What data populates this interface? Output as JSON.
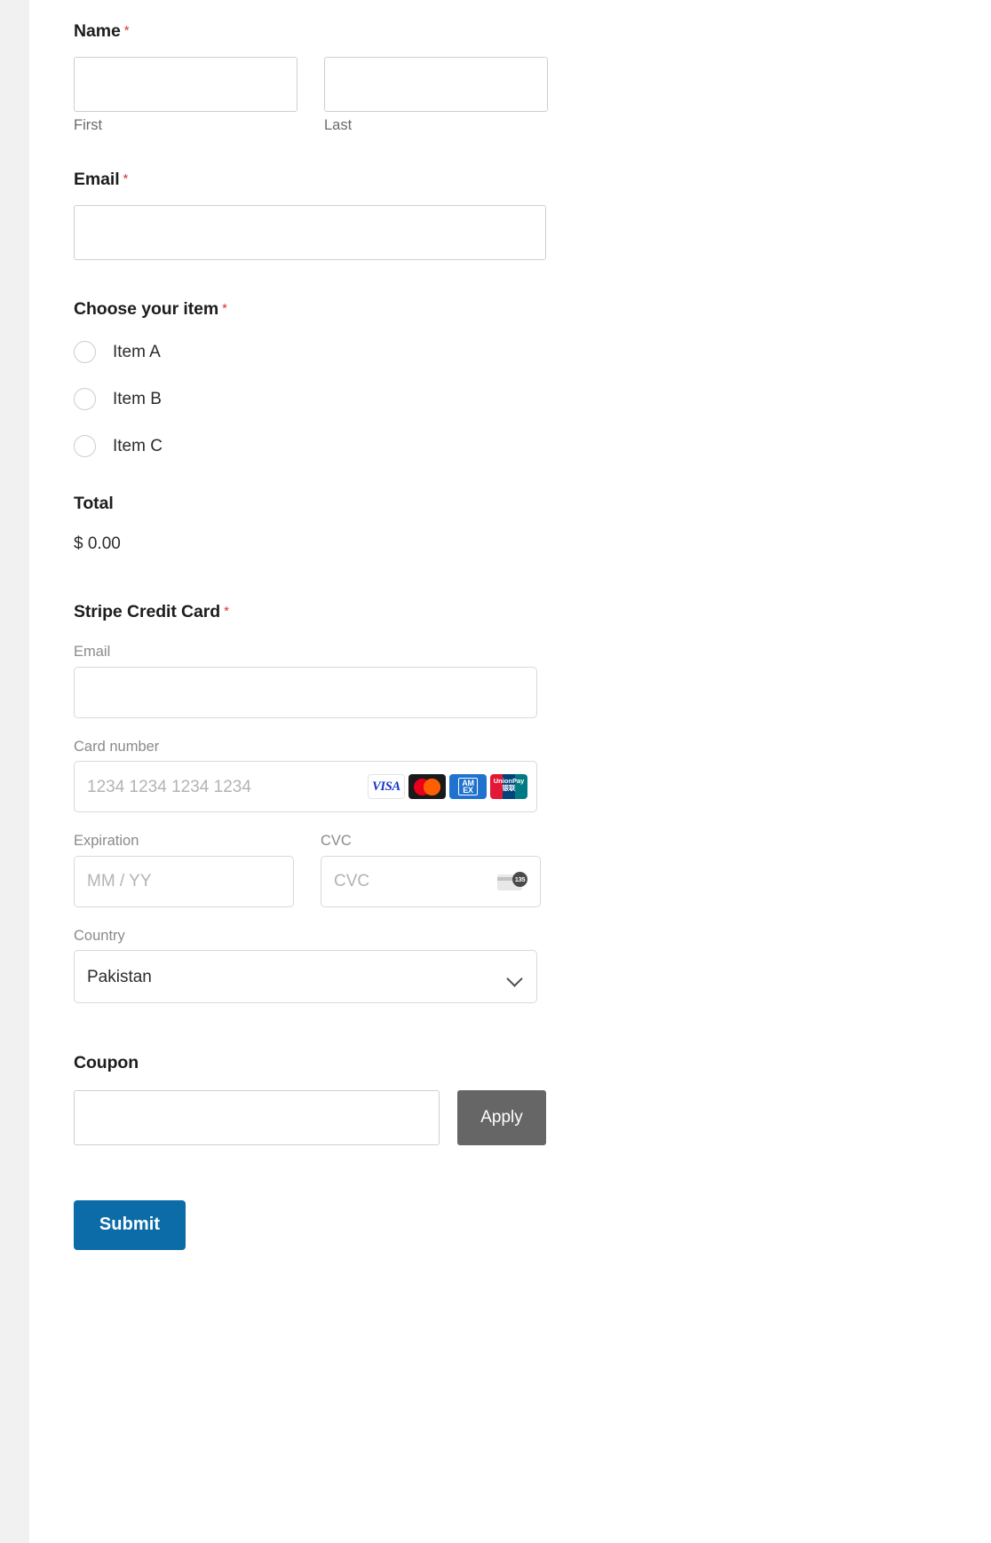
{
  "form": {
    "name": {
      "label": "Name",
      "required_mark": "*",
      "first": {
        "value": "",
        "sublabel": "First"
      },
      "last": {
        "value": "",
        "sublabel": "Last"
      }
    },
    "email": {
      "label": "Email",
      "required_mark": "*",
      "value": ""
    },
    "choose_item": {
      "label": "Choose your item",
      "required_mark": "*",
      "options": [
        {
          "label": "Item A",
          "selected": false
        },
        {
          "label": "Item B",
          "selected": false
        },
        {
          "label": "Item C",
          "selected": false
        }
      ]
    },
    "total": {
      "label": "Total",
      "value": "$ 0.00"
    },
    "stripe": {
      "label": "Stripe Credit Card",
      "required_mark": "*",
      "email": {
        "label": "Email",
        "value": ""
      },
      "card_number": {
        "label": "Card number",
        "placeholder": "1234 1234 1234 1234",
        "value": "",
        "brands": [
          "visa-icon",
          "mastercard-icon",
          "amex-icon",
          "unionpay-icon"
        ],
        "brand_text": {
          "visa": "VISA",
          "amex_line1": "AM",
          "amex_line2": "EX",
          "unionpay_line1": "UnionPay",
          "unionpay_line2": "银联"
        }
      },
      "expiration": {
        "label": "Expiration",
        "placeholder": "MM / YY",
        "value": ""
      },
      "cvc": {
        "label": "CVC",
        "placeholder": "CVC",
        "value": "",
        "icon": "cvc-card-icon",
        "icon_digits": "135"
      },
      "country": {
        "label": "Country",
        "selected": "Pakistan"
      }
    },
    "coupon": {
      "label": "Coupon",
      "value": "",
      "apply_label": "Apply"
    },
    "submit_label": "Submit"
  },
  "colors": {
    "required": "#d63638",
    "submit": "#0b6ca8",
    "apply": "#666666",
    "page_bg": "#f1f1f1",
    "canvas_bg": "#ffffff"
  }
}
